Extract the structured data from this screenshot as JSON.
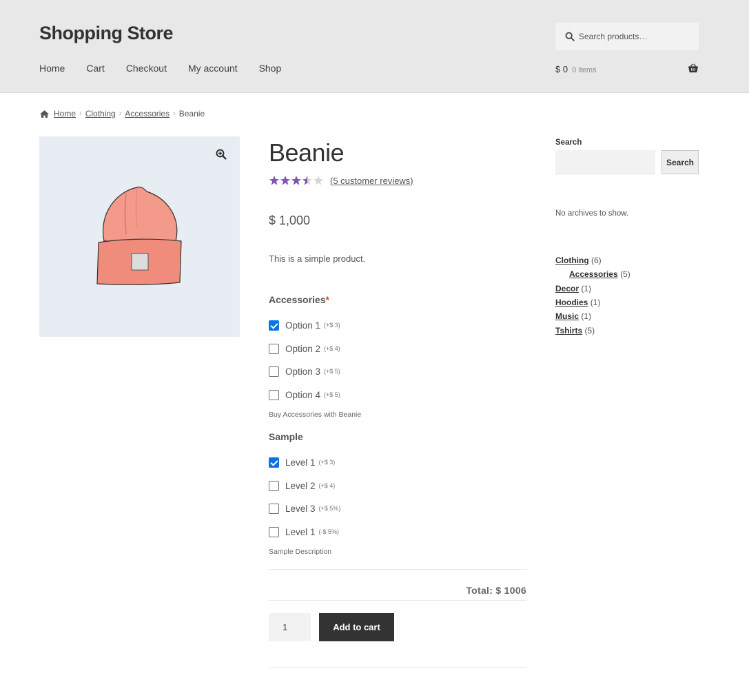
{
  "header": {
    "site_title": "Shopping Store",
    "nav": [
      "Home",
      "Cart",
      "Checkout",
      "My account",
      "Shop"
    ],
    "search_placeholder": "Search products…",
    "cart_amount": "$ 0",
    "cart_items": "0 items"
  },
  "breadcrumb": {
    "items": [
      "Home",
      "Clothing",
      "Accessories"
    ],
    "current": "Beanie"
  },
  "product": {
    "title": "Beanie",
    "rating": 3.5,
    "rating_max": 5,
    "reviews_link": "(5 customer reviews)",
    "price": "$ 1,000",
    "short_description": "This is a simple product."
  },
  "addons": {
    "accessories": {
      "title": "Accessories",
      "required_mark": "*",
      "options": [
        {
          "label": "Option 1",
          "price": "(+$ 3)",
          "checked": true
        },
        {
          "label": "Option 2",
          "price": "(+$ 4)",
          "checked": false
        },
        {
          "label": "Option 3",
          "price": "(+$ 5)",
          "checked": false
        },
        {
          "label": "Option 4",
          "price": "(+$ 5)",
          "checked": false
        }
      ],
      "description": "Buy Accessories with Beanie"
    },
    "sample": {
      "title": "Sample",
      "options": [
        {
          "label": "Level 1",
          "price": "(+$ 3)",
          "checked": true
        },
        {
          "label": "Level 2",
          "price": "(+$ 4)",
          "checked": false
        },
        {
          "label": "Level 3",
          "price": "(+$ 5%)",
          "checked": false
        },
        {
          "label": "Level 1",
          "price": "(-$ 5%)",
          "checked": false
        }
      ],
      "description": "Sample Description"
    }
  },
  "total": "Total: $ 1006",
  "cart_form": {
    "quantity": "1",
    "add_to_cart": "Add to cart"
  },
  "sidebar": {
    "search_title": "Search",
    "search_button": "Search",
    "no_archives": "No archives to show.",
    "categories": [
      {
        "name": "Clothing",
        "count": "(6)",
        "child": false
      },
      {
        "name": "Accessories",
        "count": "(5)",
        "child": true
      },
      {
        "name": "Decor",
        "count": "(1)",
        "child": false
      },
      {
        "name": "Hoodies",
        "count": "(1)",
        "child": false
      },
      {
        "name": "Music",
        "count": "(1)",
        "child": false
      },
      {
        "name": "Tshirts",
        "count": "(5)",
        "child": false
      }
    ]
  },
  "colors": {
    "star": "#7f54b3",
    "checkbox": "#0b74e5",
    "button": "#333333",
    "header_bg": "#e8e8e8"
  }
}
